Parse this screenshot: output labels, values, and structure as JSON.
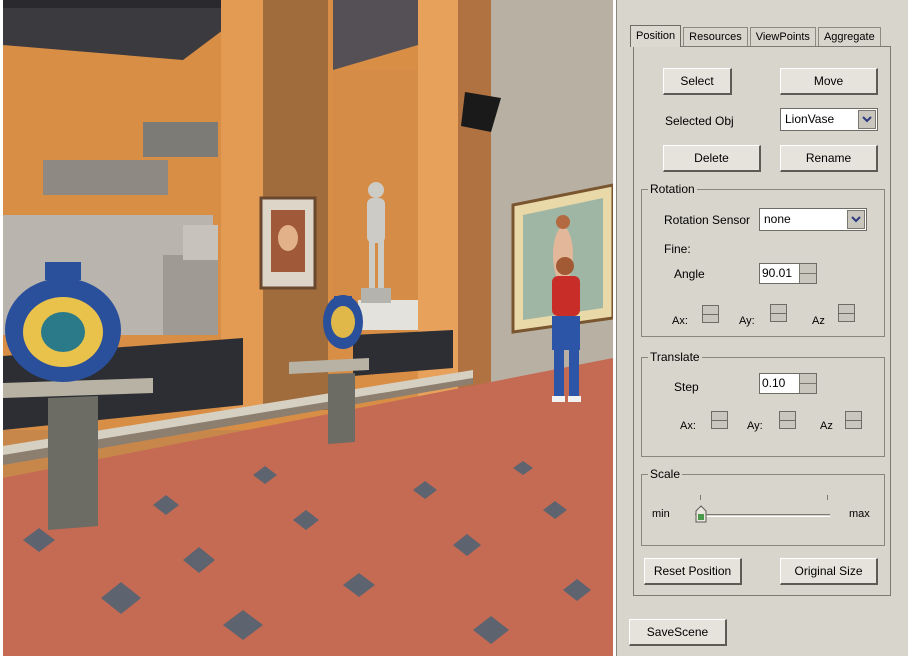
{
  "tabs": [
    {
      "label": "Position",
      "active": true
    },
    {
      "label": "Resources",
      "active": false
    },
    {
      "label": "ViewPoints",
      "active": false
    },
    {
      "label": "Aggregate",
      "active": false
    }
  ],
  "buttons": {
    "select": "Select",
    "move": "Move",
    "delete": "Delete",
    "rename": "Rename",
    "reset_position": "Reset Position",
    "original_size": "Original Size",
    "save_scene": "SaveScene"
  },
  "selected_obj": {
    "label": "Selected Obj",
    "value": "LionVase"
  },
  "rotation": {
    "title": "Rotation",
    "sensor_label": "Rotation Sensor",
    "sensor_value": "none",
    "fine_label": "Fine:",
    "angle_label": "Angle",
    "angle_value": "90.01",
    "ax_label": "Ax:",
    "ay_label": "Ay:",
    "az_label": "Az"
  },
  "translate": {
    "title": "Translate",
    "step_label": "Step",
    "step_value": "0.10",
    "ax_label": "Ax:",
    "ay_label": "Ay:",
    "az_label": "Az"
  },
  "scale": {
    "title": "Scale",
    "min_label": "min",
    "max_label": "max",
    "level": 0.0
  },
  "colors": {
    "panel_bg": "#d8d5cc",
    "wall_orange": "#d98e45",
    "floor_terracotta": "#c56a53",
    "floor_tile_dark": "#5d6470"
  }
}
